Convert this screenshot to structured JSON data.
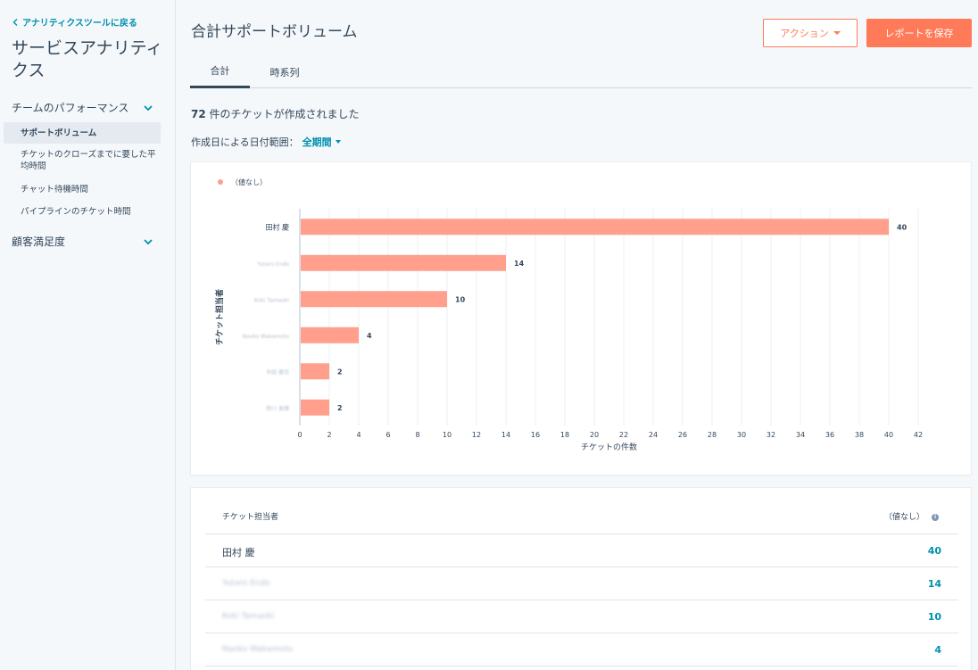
{
  "sidebar": {
    "back_label": "アナリティクスツールに戻る",
    "title": "サービスアナリティクス",
    "sections": [
      {
        "label": "チームのパフォーマンス"
      },
      {
        "label": "顧客満足度"
      }
    ],
    "items": [
      {
        "label": "サポートボリューム"
      },
      {
        "label": "チケットのクローズまでに要した平均時間"
      },
      {
        "label": "チャット待機時間"
      },
      {
        "label": "パイプラインのチケット時間"
      }
    ]
  },
  "header": {
    "title": "合計サポートボリューム",
    "action_label": "アクション",
    "save_label": "レポートを保存"
  },
  "tabs": [
    {
      "label": "合計"
    },
    {
      "label": "時系列"
    }
  ],
  "summary": {
    "count": "72",
    "text": "件のチケットが作成されました"
  },
  "date_range": {
    "label": "作成日による日付範囲：",
    "value": "全期間"
  },
  "colors": {
    "bar": "#ff9f8c",
    "accent": "#ff7a59",
    "link": "#0091ae"
  },
  "chart_data": {
    "type": "bar",
    "orientation": "horizontal",
    "legend": [
      "（値なし）"
    ],
    "legend_position": "top-left",
    "categories": [
      "田村 慶",
      "Yutaro Endo",
      "Koki Tamaoki",
      "Naoko Wakamoto",
      "市田 雅司",
      "西川 美穂"
    ],
    "values": [
      40,
      14,
      10,
      4,
      2,
      2
    ],
    "xlabel": "チケットの件数",
    "ylabel": "チケット担当者",
    "xlim": [
      0,
      42
    ],
    "xticks": [
      0,
      2,
      4,
      6,
      8,
      10,
      12,
      14,
      16,
      18,
      20,
      22,
      24,
      26,
      28,
      30,
      32,
      34,
      36,
      38,
      40,
      42
    ],
    "grid": true
  },
  "table": {
    "col1": "チケット担当者",
    "col2": "（値なし）",
    "info_icon": "i",
    "rows": [
      {
        "name": "田村 慶",
        "value": "40"
      },
      {
        "name": "Yutaro Endo",
        "value": "14"
      },
      {
        "name": "Koki Tamaoki",
        "value": "10"
      },
      {
        "name": "Naoko Wakamoto",
        "value": "4"
      }
    ]
  }
}
